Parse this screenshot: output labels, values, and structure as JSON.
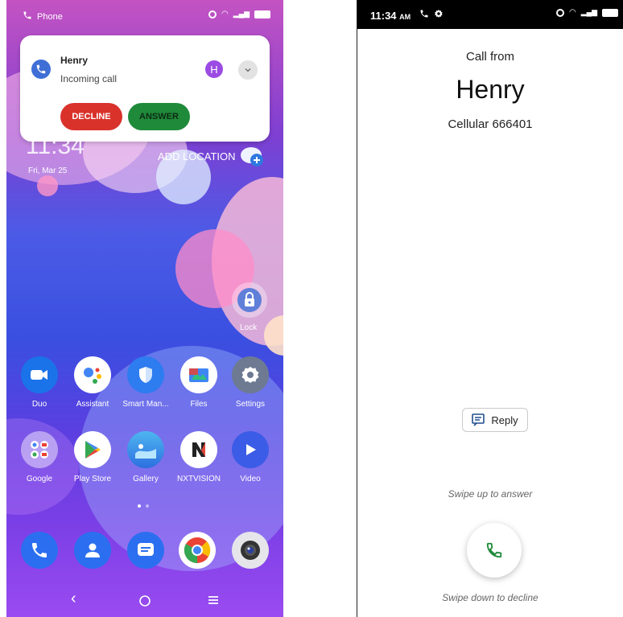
{
  "left_screen": {
    "status_bar": {
      "app_label": "Phone"
    },
    "notification": {
      "caller_name": "Henry",
      "subtitle": "Incoming call",
      "avatar_letter": "H",
      "decline_label": "DECLINE",
      "answer_label": "ANSWER",
      "colors": {
        "decline": "#d9322b",
        "answer": "#1f8a3a",
        "avatar": "#9b4be3"
      }
    },
    "lockscreen": {
      "time": "11:34",
      "ampm": "AM",
      "date": "Fri, Mar 25",
      "add_location": "ADD LOCATION",
      "lock_label": "Lock"
    },
    "apps_row1": [
      {
        "label": "Duo",
        "icon": "video-camera-icon"
      },
      {
        "label": "Assistant",
        "icon": "assistant-icon"
      },
      {
        "label": "Smart Man...",
        "icon": "shield-icon"
      },
      {
        "label": "Files",
        "icon": "files-icon"
      },
      {
        "label": "Settings",
        "icon": "gear-icon"
      }
    ],
    "apps_row2": [
      {
        "label": "Google",
        "icon": "google-folder-icon"
      },
      {
        "label": "Play Store",
        "icon": "play-store-icon"
      },
      {
        "label": "Gallery",
        "icon": "gallery-icon"
      },
      {
        "label": "NXTVISION",
        "icon": "nxtvision-icon"
      },
      {
        "label": "Video",
        "icon": "play-icon"
      }
    ],
    "dock": [
      "phone-icon",
      "contacts-icon",
      "messages-icon",
      "chrome-icon",
      "camera-icon"
    ],
    "page_indicator": {
      "count": 2,
      "active": 0
    }
  },
  "right_screen": {
    "status_bar": {
      "time": "11:34",
      "ampm": "AM"
    },
    "call_from": "Call from",
    "caller_name": "Henry",
    "caller_number": "Cellular 666401",
    "reply_label": "Reply",
    "swipe_up_hint": "Swipe up to answer",
    "swipe_down_hint": "Swipe down to decline",
    "accent": "#1f8a3a"
  }
}
